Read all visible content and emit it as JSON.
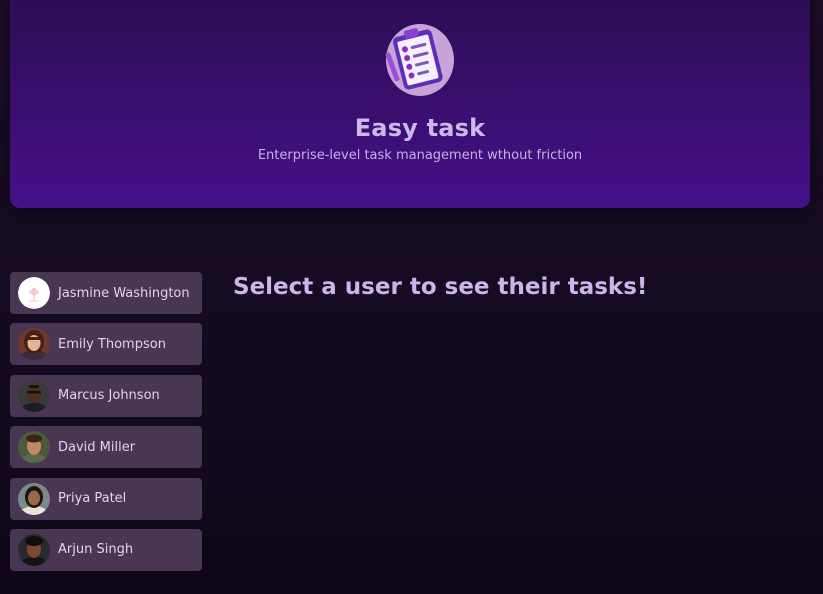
{
  "header": {
    "logo_icon": "clipboard-checklist-icon",
    "title": "Easy task",
    "subtitle": "Enterprise-level task management wthout friction"
  },
  "users": [
    {
      "name": "Jasmine Washington",
      "avatar": "flower-logo-avatar"
    },
    {
      "name": "Emily Thompson",
      "avatar": "photo-avatar"
    },
    {
      "name": "Marcus Johnson",
      "avatar": "photo-avatar"
    },
    {
      "name": "David Miller",
      "avatar": "photo-avatar"
    },
    {
      "name": "Priya Patel",
      "avatar": "photo-avatar"
    },
    {
      "name": "Arjun Singh",
      "avatar": "photo-avatar"
    }
  ],
  "main": {
    "prompt": "Select a user to see their tasks!"
  },
  "colors": {
    "header_bg": "#3a0f70",
    "page_bg": "#150b22",
    "user_item_bg": "#483652",
    "title_text": "#cdb8ec"
  }
}
